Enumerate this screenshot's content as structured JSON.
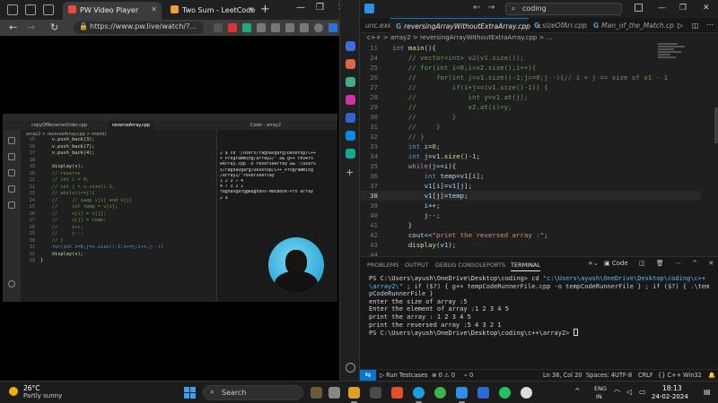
{
  "browser": {
    "tabs": [
      {
        "label": "PW Video Player",
        "color": "#e84d3d"
      },
      {
        "label": "Two Sum - LeetCode",
        "color": "#f0a030"
      }
    ],
    "url": "https://www.pw.live/watch/?..."
  },
  "video": {
    "tabs": [
      "copyOfReverseOrder.cpp",
      "reverseArray.cpp",
      "Code - array2"
    ],
    "breadcrumb": "array2 > reverseArray.cpp > main()",
    "code": [
      {
        "n": "15",
        "t": "    v.push_back(3);"
      },
      {
        "n": "16",
        "t": "    v.push_back(7);"
      },
      {
        "n": "17",
        "t": "    v.push_back(4);"
      },
      {
        "n": "18",
        "t": ""
      },
      {
        "n": "19",
        "t": "    display(v);"
      },
      {
        "n": "20",
        "t": "    // reverse"
      },
      {
        "n": "21",
        "t": "    // int i = 0;"
      },
      {
        "n": "22",
        "t": "    // int j = v.size()-1;"
      },
      {
        "n": "23",
        "t": "    // while(i<=j){"
      },
      {
        "n": "24",
        "t": "    //     // swap v[i] and v[j]"
      },
      {
        "n": "25",
        "t": "    //     int temp = v[i];"
      },
      {
        "n": "26",
        "t": "    //     v[i] = v[j];"
      },
      {
        "n": "27",
        "t": "    //     v[j] = temp;"
      },
      {
        "n": "28",
        "t": "    //     i++;"
      },
      {
        "n": "29",
        "t": "    //     j--;"
      },
      {
        "n": "30",
        "t": "    // }"
      },
      {
        "n": "31",
        "t": "    for(int i=0,j=v.size()-1;i<=j;i++,j--){"
      },
      {
        "n": "32",
        "t": "    display(v);"
      },
      {
        "n": "33",
        "t": "}"
      }
    ],
    "terminal": [
      "2 $ cd \"/Users/raghavgarg/Desktop/C++",
      "+_Programming/array2/\" && g++ revers",
      "eArray.cpp -o reverseArray && \"/Users",
      "s/raghavgarg/Desktop/C++_Programming",
      "/array2/\"reverseArray",
      "1 2 3 7 4",
      "4 7 3 2 1",
      "raghavgarg@Raghavs-MacBook-Pro array",
      "2 $"
    ]
  },
  "vscode": {
    "search": "coding",
    "tabs": [
      {
        "label": "unc.exe"
      },
      {
        "label": "reversingArrayWithoutExtraArray.cpp",
        "active": true
      },
      {
        "label": "sizeOfArr.cpp"
      },
      {
        "label": "Man_of_the_Match.cp"
      }
    ],
    "breadcrumb": "c++ > array2 > reversingArrayWithoutExtraArray.cpp > ...",
    "current_line": "38",
    "terminal": {
      "tabs": [
        "PROBLEMS",
        "OUTPUT",
        "DEBUG CONSOLE",
        "PORTS",
        "TERMINAL"
      ],
      "shell": "Code",
      "prompt1": "PS C:\\Users\\ayush\\OneDrive\\Desktop\\coding>",
      "cd": "cd",
      "path_str": "\"c:\\Users\\ayush\\OneDrive\\Desktop\\coding\\c++\\array2\\\"",
      "cmd_rest": " ; if ($?) { g++ tempCodeRunnerFile.cpp -o tempCodeRunnerFile } ; if ($?) { .\\tempCodeRunnerFile }",
      "outputs": [
        "enter the size of array :5",
        "Enter the element of array :1 2 3 4 5",
        "print the array : 1 2 3 4 5",
        "print the reversed array :5 4 3 2 1"
      ],
      "prompt2": "PS C:\\Users\\ayush\\OneDrive\\Desktop\\coding\\c++\\array2>"
    },
    "status": {
      "run": "Run Testcases",
      "problems": "⊗ 0 ⚠ 0",
      "ports": "0",
      "position": "Ln 38, Col 20",
      "spaces": "Spaces: 4",
      "encoding": "UTF-8",
      "eol": "CRLF",
      "lang": "{} C++",
      "platform": "Win32"
    }
  },
  "taskbar": {
    "temp": "26°C",
    "weather": "Partly sunny",
    "search": "Search",
    "lang1": "ENG",
    "lang2": "IN",
    "time": "18:13",
    "date": "24-02-2024"
  },
  "colors": {
    "accent": "#0078d4",
    "taskbar_bg": "#1c1c1c",
    "editor_bg": "#1f1f1f"
  }
}
